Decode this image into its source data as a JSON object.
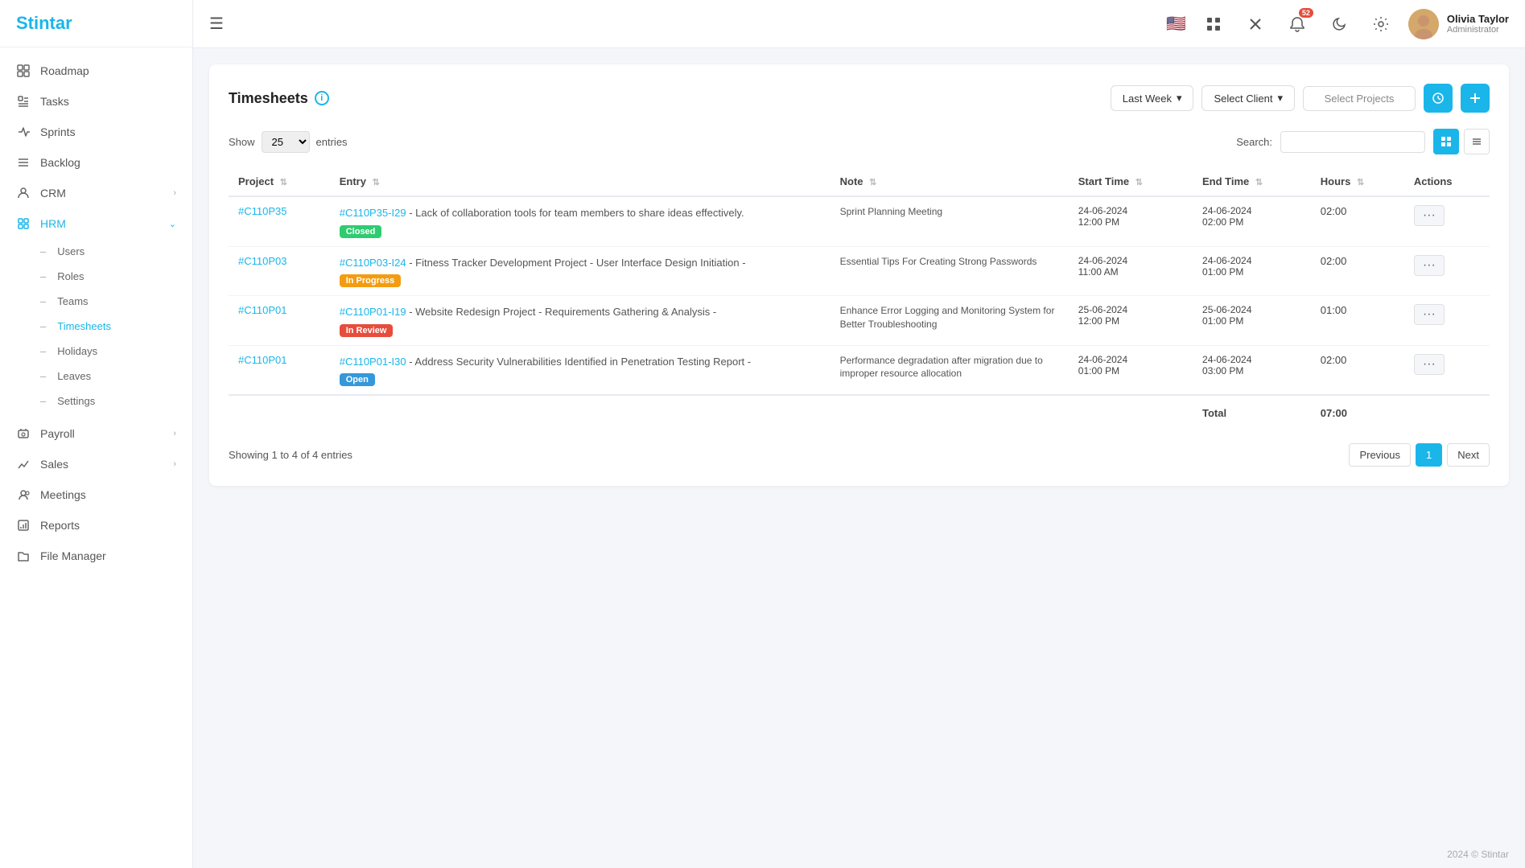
{
  "sidebar": {
    "logo": "Stintar",
    "items": [
      {
        "id": "roadmap",
        "label": "Roadmap",
        "icon": "⊞",
        "hasChildren": false
      },
      {
        "id": "tasks",
        "label": "Tasks",
        "icon": "☑",
        "hasChildren": false
      },
      {
        "id": "sprints",
        "label": "Sprints",
        "icon": "⚡",
        "hasChildren": false
      },
      {
        "id": "backlog",
        "label": "Backlog",
        "icon": "≡",
        "hasChildren": false
      },
      {
        "id": "crm",
        "label": "CRM",
        "icon": "👤",
        "hasChildren": true
      },
      {
        "id": "hrm",
        "label": "HRM",
        "icon": "💼",
        "hasChildren": true,
        "active": true,
        "expanded": true
      },
      {
        "id": "payroll",
        "label": "Payroll",
        "icon": "💰",
        "hasChildren": true
      },
      {
        "id": "sales",
        "label": "Sales",
        "icon": "📊",
        "hasChildren": true
      },
      {
        "id": "meetings",
        "label": "Meetings",
        "icon": "📅",
        "hasChildren": false
      },
      {
        "id": "reports",
        "label": "Reports",
        "icon": "📈",
        "hasChildren": false
      },
      {
        "id": "filemanager",
        "label": "File Manager",
        "icon": "📁",
        "hasChildren": false
      }
    ],
    "hrm_sub_items": [
      {
        "id": "users",
        "label": "Users"
      },
      {
        "id": "roles",
        "label": "Roles"
      },
      {
        "id": "teams",
        "label": "Teams"
      },
      {
        "id": "timesheets",
        "label": "Timesheets",
        "active": true
      },
      {
        "id": "holidays",
        "label": "Holidays"
      },
      {
        "id": "leaves",
        "label": "Leaves"
      },
      {
        "id": "settings",
        "label": "Settings"
      }
    ]
  },
  "topbar": {
    "menu_icon": "☰",
    "notification_count": "52",
    "user": {
      "name": "Olivia Taylor",
      "role": "Administrator"
    }
  },
  "page": {
    "title": "Timesheets",
    "filters": {
      "period_label": "Last Week",
      "client_label": "Select Client",
      "project_label": "Select Projects"
    },
    "table": {
      "show_label": "Show",
      "entries_label": "entries",
      "search_label": "Search:",
      "show_value": "25",
      "columns": [
        "Project",
        "Entry",
        "Note",
        "Start Time",
        "End Time",
        "Hours",
        "Actions"
      ],
      "rows": [
        {
          "project": "#C110P35",
          "entry_id": "#C110P35-I29",
          "entry_text": "Lack of collaboration tools for team members to share ideas effectively.",
          "status": "Closed",
          "status_class": "closed",
          "note": "Sprint Planning Meeting",
          "start_time": "24-06-2024 12:00 PM",
          "end_time": "24-06-2024 02:00 PM",
          "hours": "02:00"
        },
        {
          "project": "#C110P03",
          "entry_id": "#C110P03-I24",
          "entry_text": "Fitness Tracker Development Project - User Interface Design Initiation -",
          "status": "In Progress",
          "status_class": "inprogress",
          "note": "Essential Tips For Creating Strong Passwords",
          "start_time": "24-06-2024 11:00 AM",
          "end_time": "24-06-2024 01:00 PM",
          "hours": "02:00"
        },
        {
          "project": "#C110P01",
          "entry_id": "#C110P01-I19",
          "entry_text": "Website Redesign Project - Requirements Gathering & Analysis -",
          "status": "In Review",
          "status_class": "inreview",
          "note": "Enhance Error Logging and Monitoring System for Better Troubleshooting",
          "start_time": "25-06-2024 12:00 PM",
          "end_time": "25-06-2024 01:00 PM",
          "hours": "01:00"
        },
        {
          "project": "#C110P01",
          "entry_id": "#C110P01-I30",
          "entry_text": "Address Security Vulnerabilities Identified in Penetration Testing Report -",
          "status": "Open",
          "status_class": "open",
          "note": "Performance degradation after migration due to improper resource allocation",
          "start_time": "24-06-2024 01:00 PM",
          "end_time": "24-06-2024 03:00 PM",
          "hours": "02:00"
        }
      ],
      "total_label": "Total",
      "total_hours": "07:00",
      "showing_text": "Showing 1 to 4 of 4 entries",
      "prev_label": "Previous",
      "next_label": "Next",
      "current_page": "1"
    }
  },
  "footer": {
    "text": "2024 © Stintar"
  }
}
